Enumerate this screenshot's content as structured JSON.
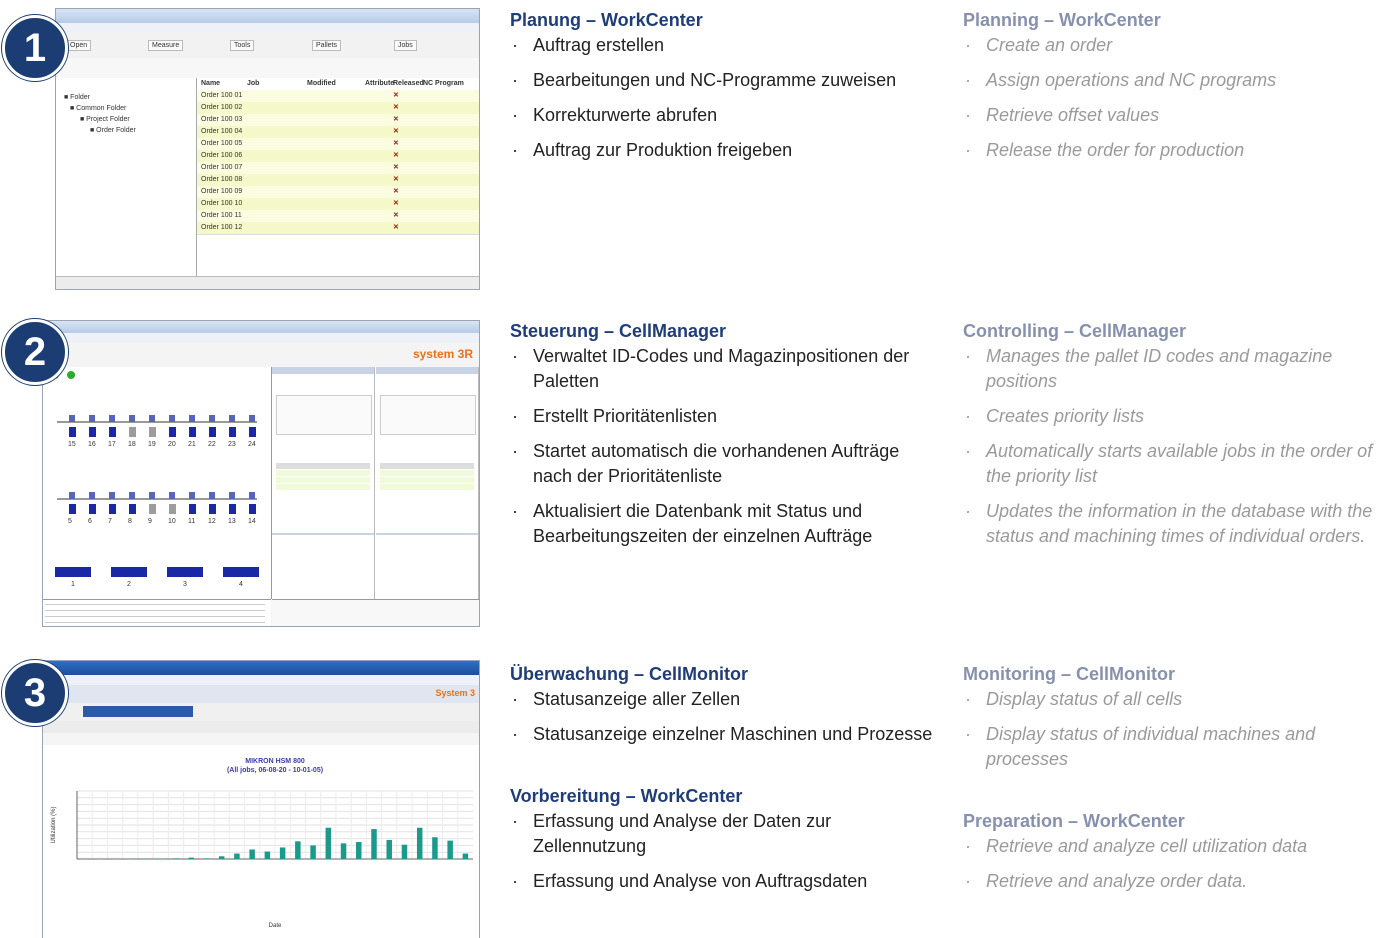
{
  "sections": [
    {
      "number": "1",
      "de": {
        "title": "Planung – WorkCenter",
        "items": [
          "Auftrag erstellen",
          "Bearbeitungen und NC-Programme zuweisen",
          "Korrekturwerte abrufen",
          "Auftrag zur Produktion freigeben"
        ]
      },
      "en": {
        "title": "Planning – WorkCenter",
        "items": [
          "Create an order",
          "Assign operations and NC programs",
          "Retrieve offset values",
          "Release the order for production"
        ]
      }
    },
    {
      "number": "2",
      "de": {
        "title": "Steuerung – CellManager",
        "items": [
          "Verwaltet ID-Codes und Magazinpositionen der Paletten",
          "Erstellt Prioritätenlisten",
          "Startet automatisch die vorhandenen Aufträge nach der Prioritätenliste",
          "Aktualisiert die Datenbank mit Status und Bearbeitungszeiten der einzelnen Aufträge"
        ]
      },
      "en": {
        "title": "Controlling – CellManager",
        "items": [
          "Manages the pallet ID codes and magazine positions",
          "Creates priority lists",
          "Automatically starts available jobs in the order of the priority list",
          "Updates the information in the database with the status and machining times of individual orders."
        ]
      }
    },
    {
      "number": "3",
      "de": {
        "title": "Überwachung – CellMonitor",
        "items": [
          "Statusanzeige aller Zellen",
          "Statusanzeige einzelner Maschinen und Prozesse"
        ],
        "title2": "Vorbereitung – WorkCenter",
        "items2": [
          "Erfassung und Analyse der Daten zur Zellennutzung",
          "Erfassung und Analyse von Auftragsdaten"
        ]
      },
      "en": {
        "title": "Monitoring – CellMonitor",
        "items": [
          "Display status of all cells",
          "Display status of individual machines and processes"
        ],
        "title2": "Preparation – WorkCenter",
        "items2": [
          "Retrieve and analyze cell utilization data",
          "Retrieve and analyze order data."
        ]
      }
    }
  ],
  "screenshots": {
    "s1": {
      "toolbar": [
        "Open",
        "Measure",
        "Tools",
        "Pallets",
        "Jobs"
      ],
      "tree": [
        "Folder",
        "Common Folder",
        "Project Folder",
        "Order Folder"
      ],
      "columns": [
        "Name",
        "Job",
        "Modified",
        "Attribute",
        "Released",
        "NC Program"
      ],
      "orders": [
        "Order 100 01",
        "Order 100 02",
        "Order 100 03",
        "Order 100 04",
        "Order 100 05",
        "Order 100 06",
        "Order 100 07",
        "Order 100 08",
        "Order 100 09",
        "Order 100 10",
        "Order 100 11",
        "Order 100 12"
      ]
    },
    "s2": {
      "brand": "system 3R",
      "positions_top": [
        "15",
        "16",
        "17",
        "18",
        "19",
        "20",
        "21",
        "22",
        "23",
        "24"
      ],
      "positions_bottom": [
        "5",
        "6",
        "7",
        "8",
        "9",
        "10",
        "11",
        "12",
        "13",
        "14"
      ],
      "machines": [
        "1",
        "2",
        "3",
        "4"
      ]
    },
    "s3": {
      "chart_data": {
        "type": "bar",
        "title": "MIKRON HSM 800",
        "subtitle": "(All jobs, 06-08-20 - 10-01-05)",
        "xlabel": "Date",
        "ylabel": "Utilization (%)",
        "ylim": [
          0,
          100
        ],
        "values": [
          0,
          0,
          0,
          0,
          0,
          0,
          1,
          2,
          1,
          4,
          8,
          14,
          11,
          17,
          26,
          20,
          46,
          23,
          25,
          44,
          28,
          21,
          46,
          32,
          27,
          8
        ]
      }
    }
  }
}
